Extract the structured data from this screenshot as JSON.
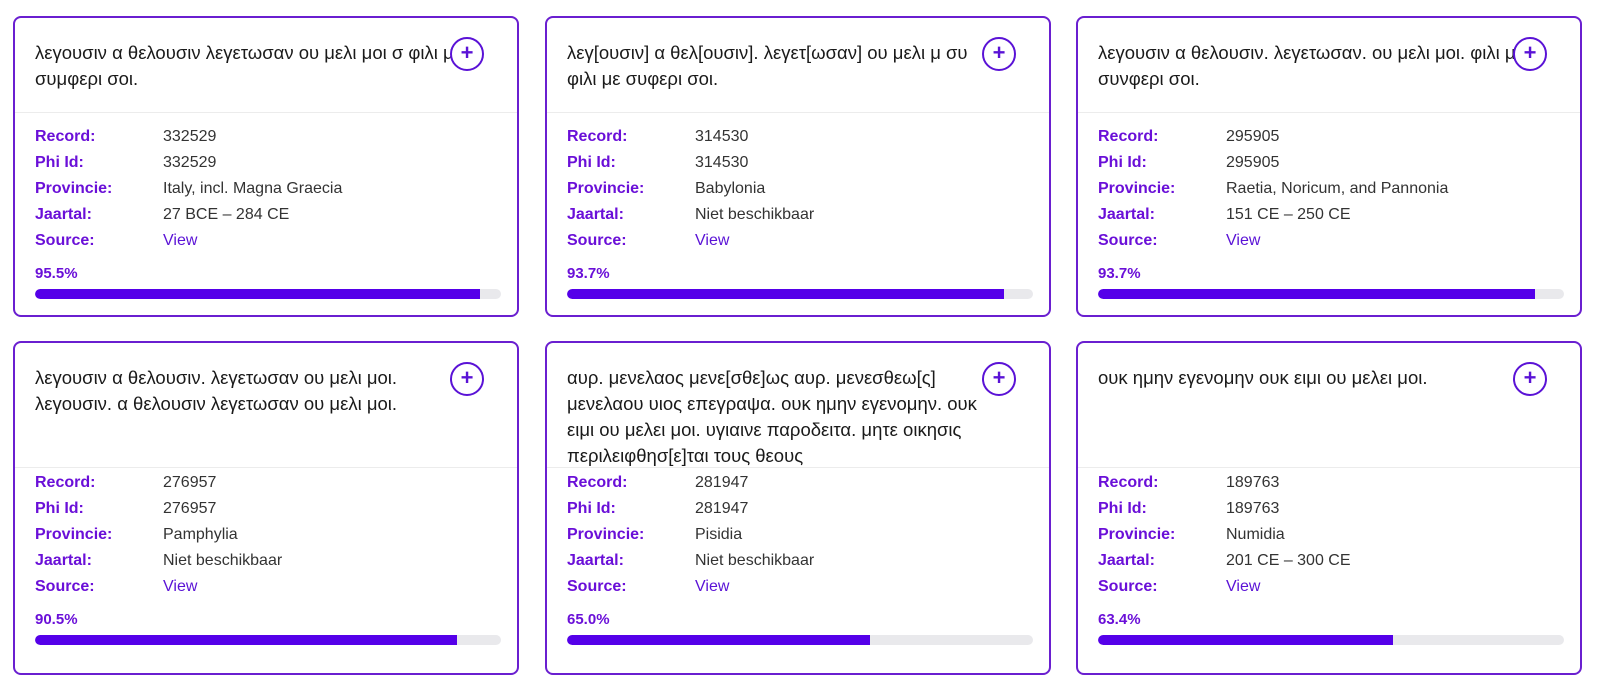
{
  "labels": {
    "record": "Record:",
    "phi_id": "Phi Id:",
    "provincie": "Provincie:",
    "jaartal": "Jaartal:",
    "source": "Source:"
  },
  "add_symbol": "+",
  "colors": {
    "accent": "#6a1fd0",
    "bar": "#5500e9",
    "bar_track": "#e9e9ec"
  },
  "cards": [
    {
      "text": "λεγουσιν α θελουσιν λεγετωσαν ου μελι μοι σ φιλι με συμφερι σοι.",
      "record": "332529",
      "phi_id": "332529",
      "provincie": "Italy, incl. Magna Graecia",
      "jaartal": "27 BCE – 284 CE",
      "source": "View",
      "score": "95.5%",
      "score_value": 0.955
    },
    {
      "text": "λεγ[ουσιν] α θελ[ουσιν]. λεγετ[ωσαν] ου μελι μ συ φιλι με συφερι σοι.",
      "record": "314530",
      "phi_id": "314530",
      "provincie": "Babylonia",
      "jaartal": "Niet beschikbaar",
      "source": "View",
      "score": "93.7%",
      "score_value": 0.937
    },
    {
      "text": "λεγουσιν α θελουσιν. λεγετωσαν. ου μελι μοι. φιλι με συνφερι σοι.",
      "record": "295905",
      "phi_id": "295905",
      "provincie": "Raetia, Noricum, and Pannonia",
      "jaartal": "151 CE – 250 CE",
      "source": "View",
      "score": "93.7%",
      "score_value": 0.937
    },
    {
      "text": "λεγουσιν α θελουσιν. λεγετωσαν ου μελι μοι. λεγουσιν. α θελουσιν λεγετωσαν ου μελι μοι.",
      "record": "276957",
      "phi_id": "276957",
      "provincie": "Pamphylia",
      "jaartal": "Niet beschikbaar",
      "source": "View",
      "score": "90.5%",
      "score_value": 0.905
    },
    {
      "text": "αυρ. μενελαος μενε[σθε]ως αυρ. μενεσθεω[ς] μενελαου υιος επεγραψα. ουκ ημην εγενομην. ουκ ειμι ου μελει μοι. υγιαινε παροδειτα. μητε οικησις περιλειφθησ[ε]ται τους θεους",
      "record": "281947",
      "phi_id": "281947",
      "provincie": "Pisidia",
      "jaartal": "Niet beschikbaar",
      "source": "View",
      "score": "65.0%",
      "score_value": 0.65
    },
    {
      "text": "ουκ ημην εγενομην ουκ ειμι ου μελει μοι.",
      "record": "189763",
      "phi_id": "189763",
      "provincie": "Numidia",
      "jaartal": "201 CE – 300 CE",
      "source": "View",
      "score": "63.4%",
      "score_value": 0.634
    }
  ]
}
